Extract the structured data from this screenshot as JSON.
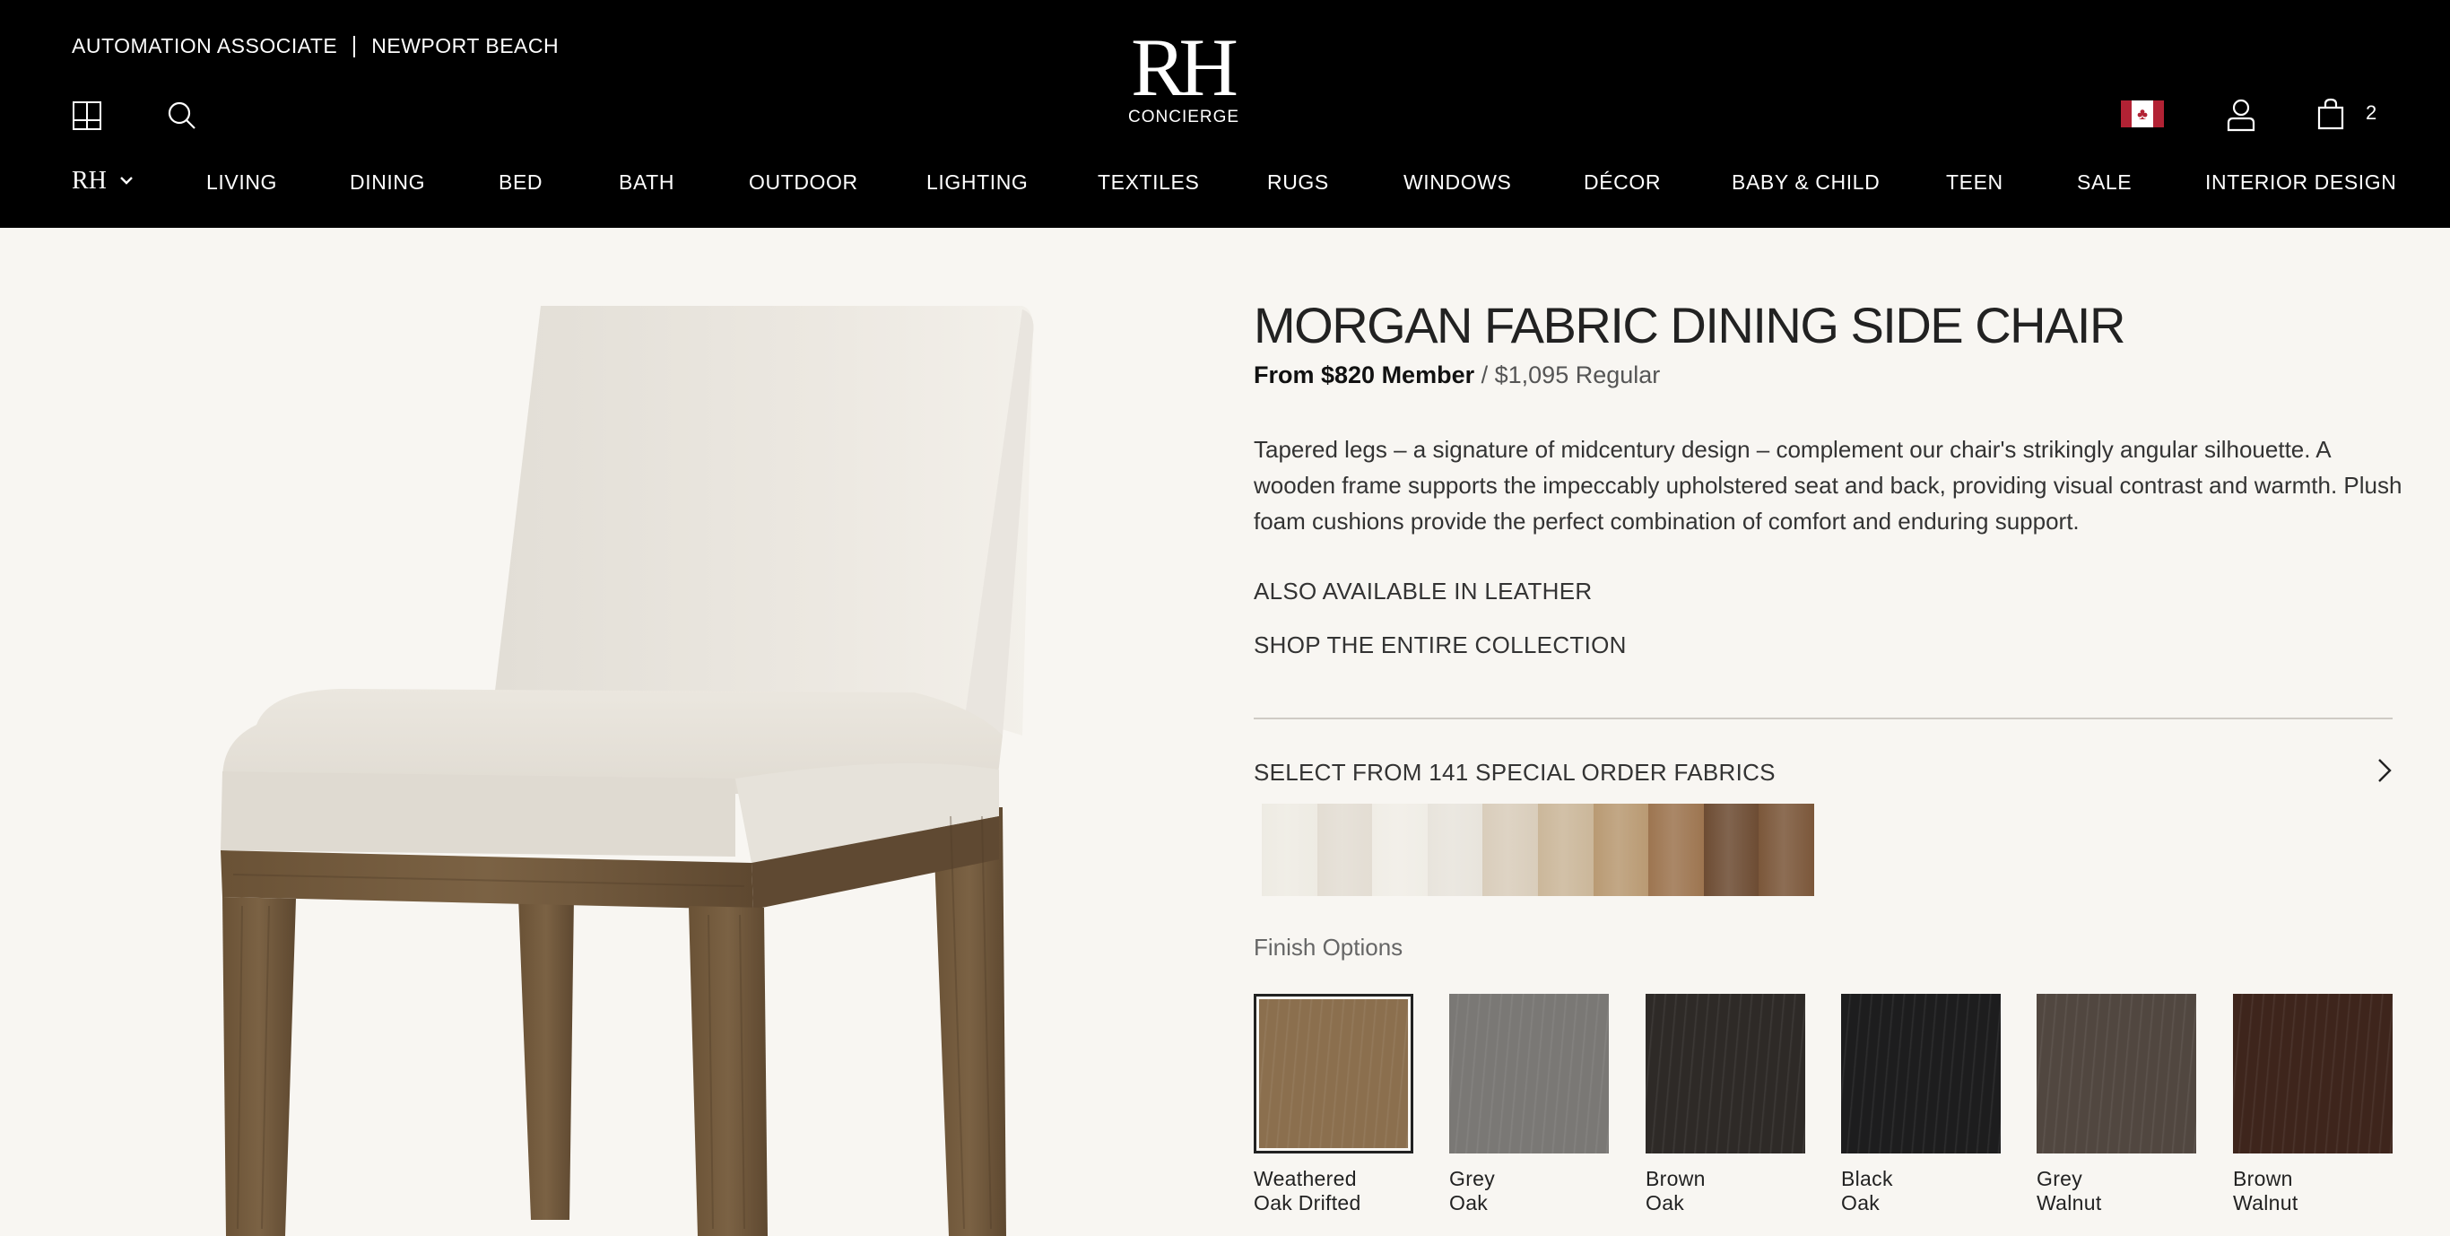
{
  "header": {
    "associate_label": "AUTOMATION ASSOCIATE",
    "location": "NEWPORT BEACH",
    "logo_mark": "RH",
    "logo_sub": "CONCIERGE",
    "cart_count": "2",
    "icons": [
      "floorplan-icon",
      "search-icon",
      "canada-flag-icon",
      "account-icon",
      "cart-icon"
    ]
  },
  "nav": {
    "brand": "RH",
    "items": [
      "LIVING",
      "DINING",
      "BED",
      "BATH",
      "OUTDOOR",
      "LIGHTING",
      "TEXTILES",
      "RUGS",
      "WINDOWS",
      "DÉCOR",
      "BABY & CHILD",
      "TEEN",
      "SALE",
      "INTERIOR DESIGN"
    ]
  },
  "product": {
    "title": "MORGAN FABRIC DINING SIDE CHAIR",
    "price_member": "From $820 Member",
    "price_sep": " / ",
    "price_regular": "$1,095 Regular",
    "description": "Tapered legs – a signature of midcentury design – complement our chair's strikingly angular silhouette. A wooden frame supports the impeccably upholstered seat and back, providing visual contrast and warmth. Plush foam cushions provide the perfect combination of comfort and enduring support.",
    "link_leather": "ALSO AVAILABLE IN LEATHER",
    "link_collection": "SHOP THE ENTIRE COLLECTION",
    "fabrics_label": "SELECT FROM 141 SPECIAL ORDER FABRICS",
    "fabric_colors": [
      "#eeebe3",
      "#e3ddd3",
      "#f0ede6",
      "#e8e4dc",
      "#d9cdbb",
      "#cbb79a",
      "#b99a73",
      "#9d7550",
      "#6d4c33",
      "#7b573a"
    ],
    "finish_label": "Finish Options",
    "finishes": [
      {
        "line1": "Weathered",
        "line2": "Oak Drifted",
        "color": "#8b6f4e",
        "selected": true
      },
      {
        "line1": "Grey",
        "line2": "Oak",
        "color": "#7a7875"
      },
      {
        "line1": "Brown",
        "line2": "Oak",
        "color": "#2e2a27"
      },
      {
        "line1": "Black",
        "line2": "Oak",
        "color": "#1d1d1e"
      },
      {
        "line1": "Grey",
        "line2": "Walnut",
        "color": "#514740"
      },
      {
        "line1": "Brown",
        "line2": "Walnut",
        "color": "#3e251c"
      }
    ]
  },
  "colors": {
    "header_bg": "#000000",
    "page_bg": "#f8f6f2",
    "upholstery": "#e9e5dd",
    "wood": "#6b5538"
  }
}
